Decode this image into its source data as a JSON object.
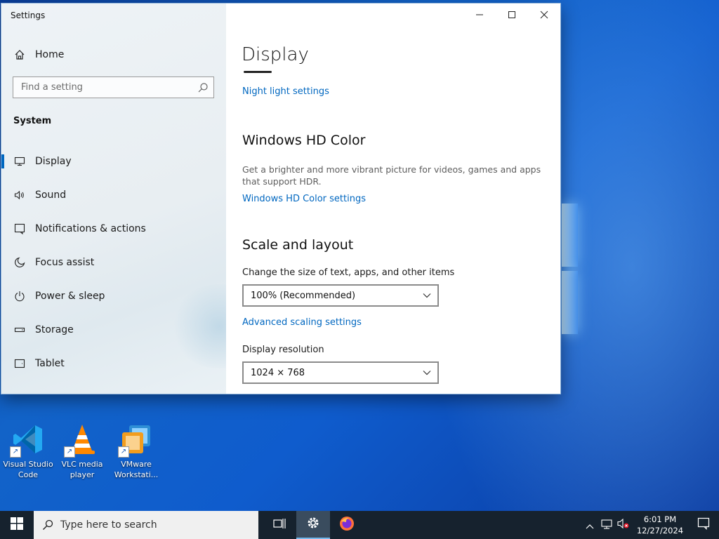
{
  "window": {
    "title": "Settings",
    "controls": [
      "minimize-icon",
      "maximize-icon",
      "close-icon"
    ]
  },
  "nav": {
    "home_label": "Home",
    "search_placeholder": "Find a setting",
    "section_label": "System",
    "items": [
      {
        "label": "Display",
        "icon": "monitor-icon",
        "selected": true
      },
      {
        "label": "Sound",
        "icon": "speaker-icon",
        "selected": false
      },
      {
        "label": "Notifications & actions",
        "icon": "notification-icon",
        "selected": false
      },
      {
        "label": "Focus assist",
        "icon": "moon-icon",
        "selected": false
      },
      {
        "label": "Power & sleep",
        "icon": "power-icon",
        "selected": false
      },
      {
        "label": "Storage",
        "icon": "storage-icon",
        "selected": false
      },
      {
        "label": "Tablet",
        "icon": "tablet-icon",
        "selected": false
      }
    ]
  },
  "content": {
    "page_title": "Display",
    "night_light_link": "Night light settings",
    "hd_color": {
      "heading": "Windows HD Color",
      "description": "Get a brighter and more vibrant picture for videos, games and apps that support HDR.",
      "link": "Windows HD Color settings"
    },
    "scale": {
      "heading": "Scale and layout",
      "size_label": "Change the size of text, apps, and other items",
      "size_value": "100% (Recommended)",
      "advanced_link": "Advanced scaling settings",
      "resolution_label": "Display resolution",
      "resolution_value": "1024 × 768"
    }
  },
  "desktop": {
    "icons": [
      {
        "label_line1": "Visual Studio",
        "label_line2": "Code",
        "icon": "vscode-icon"
      },
      {
        "label_line1": "VLC media",
        "label_line2": "player",
        "icon": "vlc-icon"
      },
      {
        "label_line1": "VMware",
        "label_line2": "Workstati...",
        "icon": "vmware-icon"
      }
    ]
  },
  "taskbar": {
    "search_placeholder": "Type here to search",
    "clock_time": "6:01 PM",
    "clock_date": "12/27/2024"
  },
  "colors": {
    "accent": "#0067c0",
    "taskbar": "#16222e",
    "desktop": "#1263c8"
  }
}
